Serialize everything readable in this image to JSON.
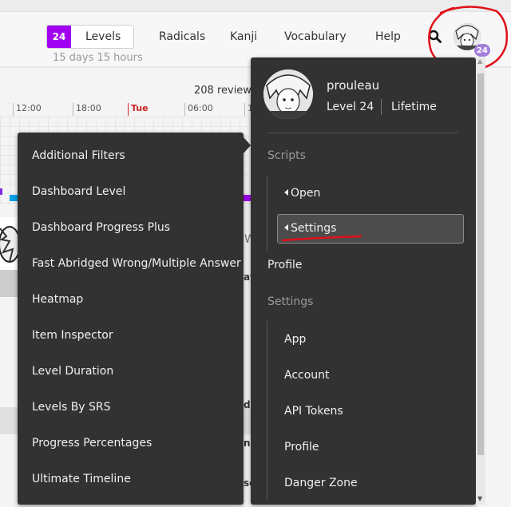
{
  "nav": {
    "level_number": "24",
    "levels_label": "Levels",
    "level_timer": "15 days 15 hours",
    "items": [
      "Radicals",
      "Kanji",
      "Vocabulary",
      "Help"
    ],
    "avatar_level": "24"
  },
  "background": {
    "reviews_text": "208 review",
    "timeline_ticks": [
      "12:00",
      "18:00",
      "Tue",
      "06:00",
      "1"
    ],
    "fragment_w": "W",
    "fragments": [
      "ay",
      "d",
      "nc",
      "sc"
    ]
  },
  "scripts_menu": {
    "items": [
      "Additional Filters",
      "Dashboard Level",
      "Dashboard Progress Plus",
      "Fast Abridged Wrong/Multiple Answer",
      "Heatmap",
      "Item Inspector",
      "Level Duration",
      "Levels By SRS",
      "Progress Percentages",
      "Ultimate Timeline"
    ]
  },
  "profile_menu": {
    "username": "prouleau",
    "level_text": "Level 24",
    "lifetime_text": "Lifetime",
    "scripts_heading": "Scripts",
    "open_label": "Open",
    "settings_label": "Settings",
    "profile_label": "Profile",
    "settings_heading": "Settings",
    "settings_items": [
      "App",
      "Account",
      "API Tokens",
      "Profile",
      "Danger Zone"
    ]
  },
  "colors": {
    "level_badge": "#a100f1",
    "menu_bg": "#323232",
    "annotation_red": "#e0101a"
  }
}
